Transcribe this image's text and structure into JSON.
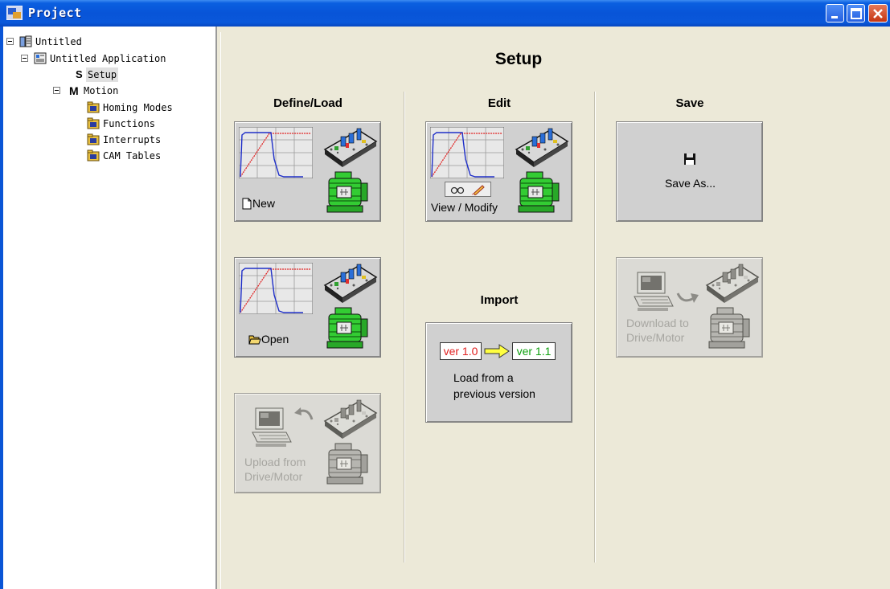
{
  "window": {
    "title": "Project"
  },
  "tree": {
    "root": "Untitled",
    "application": "Untitled Application",
    "setup_prefix": "S",
    "setup": "Setup",
    "motion_prefix": "M",
    "motion": "Motion",
    "motion_children": [
      "Homing Modes",
      "Functions",
      "Interrupts",
      "CAM Tables"
    ]
  },
  "main": {
    "title": "Setup",
    "sections": {
      "define_load": "Define/Load",
      "edit": "Edit",
      "save": "Save",
      "import": "Import"
    },
    "cards": {
      "new": "New",
      "open": "Open",
      "upload_line1": "Upload from",
      "upload_line2": "Drive/Motor",
      "view_modify": "View / Modify",
      "import_from_ver": "ver 1.0",
      "import_to_ver": "ver 1.1",
      "import_line1": "Load from a",
      "import_line2": "previous version",
      "save_as": "Save As...",
      "download_line1": "Download to",
      "download_line2": "Drive/Motor"
    }
  },
  "colors": {
    "titlebar": "#0854D8",
    "panel": "#ECE9D8",
    "card": "#D0D0D0",
    "disabled_text": "#8A8A8A",
    "motor_green": "#33CC33",
    "plot_blue": "#1F2FC8",
    "plot_red": "#E02020"
  }
}
